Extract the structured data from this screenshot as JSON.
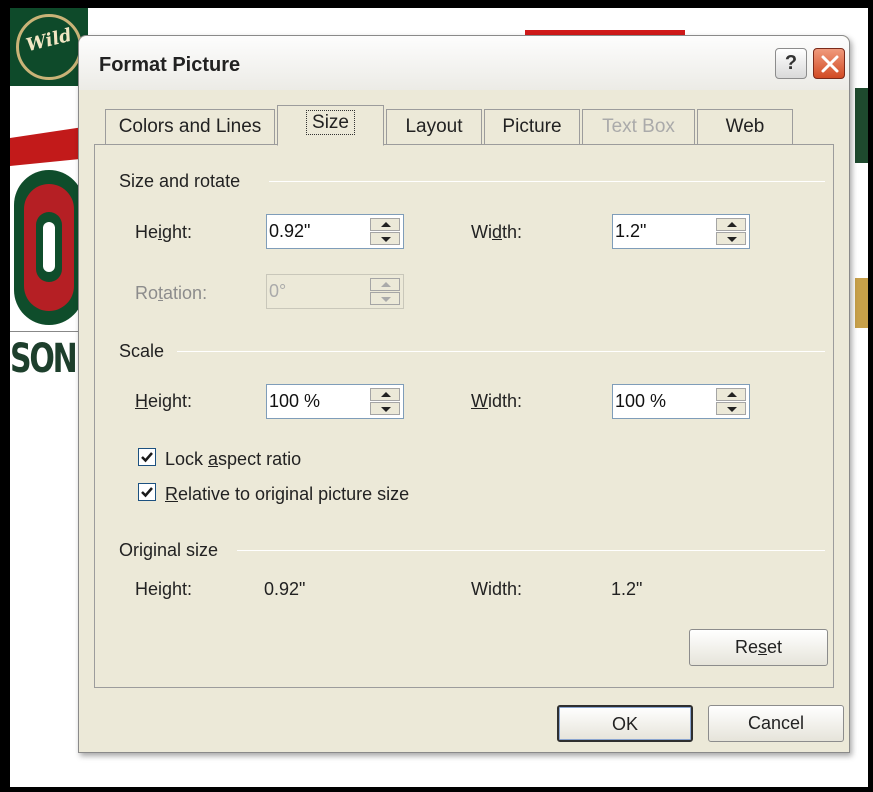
{
  "dialog": {
    "title": "Format Picture",
    "help_label": "?",
    "tabs": [
      {
        "label": "Colors and Lines",
        "state": "normal"
      },
      {
        "label": "Size",
        "state": "active"
      },
      {
        "label": "Layout",
        "state": "normal"
      },
      {
        "label": "Picture",
        "state": "normal"
      },
      {
        "label": "Text Box",
        "state": "disabled"
      },
      {
        "label": "Web",
        "state": "normal"
      }
    ]
  },
  "size_rotate": {
    "group_label": "Size and rotate",
    "height_label": "Height:",
    "height_value": "0.92\"",
    "width_label": "Width:",
    "width_value": "1.2\"",
    "rotation_label": "Rotation:",
    "rotation_value": "0°"
  },
  "scale": {
    "group_label": "Scale",
    "height_label": "Height:",
    "height_value": "100 %",
    "width_label": "Width:",
    "width_value": "100 %",
    "lock_aspect_label": "Lock aspect ratio",
    "lock_aspect_checked": true,
    "relative_label": "Relative to original picture size",
    "relative_checked": true
  },
  "original_size": {
    "group_label": "Original size",
    "height_label": "Height:",
    "height_value": "0.92\"",
    "width_label": "Width:",
    "width_value": "1.2\""
  },
  "buttons": {
    "reset": "Reset",
    "ok": "OK",
    "cancel": "Cancel"
  },
  "background": {
    "logo_text": "Wild",
    "partial_text": "SON"
  }
}
